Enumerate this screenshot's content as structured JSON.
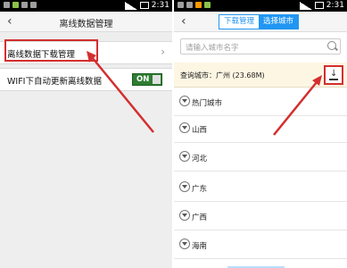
{
  "status": {
    "time": "2:31"
  },
  "left": {
    "title": "离线数据管理",
    "back_icon": "‹",
    "rows": [
      {
        "label": "离线数据下载管理",
        "chevron": "›"
      },
      {
        "label": "WIFI下自动更新离线数据",
        "toggle": "ON"
      }
    ]
  },
  "right": {
    "back_icon": "‹",
    "tabs": [
      {
        "label": "下载管理",
        "active": false
      },
      {
        "label": "选择城市",
        "active": true
      }
    ],
    "search": {
      "placeholder": "请输入城市名字",
      "icon": "search-icon"
    },
    "current_city": "查询城市：广州 (23.68M)",
    "download_icon": "download-icon",
    "cities": [
      "热门城市",
      "山西",
      "河北",
      "广东",
      "广西",
      "海南"
    ]
  },
  "colors": {
    "accent": "#2196f3",
    "toggle": "#2e7d32",
    "highlight": "#d32f2f"
  }
}
